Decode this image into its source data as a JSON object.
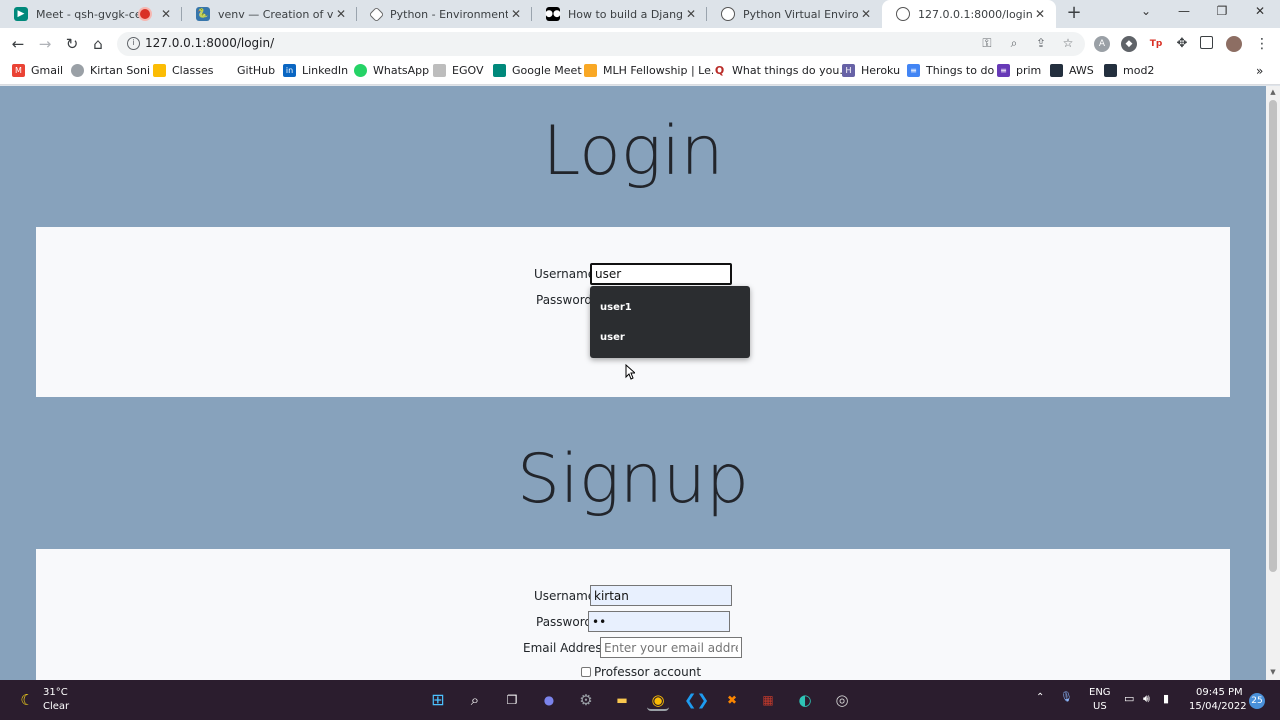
{
  "browser": {
    "tabs": [
      {
        "title": "Meet - qsh-gvgk-cev",
        "recording": true
      },
      {
        "title": "venv — Creation of virtual e"
      },
      {
        "title": "Python - Environment Setu"
      },
      {
        "title": "How to build a Django web"
      },
      {
        "title": "Python Virtual Environment"
      },
      {
        "title": "127.0.0.1:8000/login/",
        "active": true
      }
    ],
    "url": "127.0.0.1:8000/login/",
    "bookmarks": [
      "Gmail",
      "Kirtan Soni",
      "Classes",
      "GitHub",
      "LinkedIn",
      "WhatsApp",
      "EGOV",
      "Google Meet",
      "MLH Fellowship | Le...",
      "What things do you...",
      "Heroku",
      "Things to do",
      "prim",
      "AWS",
      "mod2"
    ],
    "accent": "#87a2bc"
  },
  "login": {
    "heading": "Login",
    "username_label": "Username",
    "username_value": "user",
    "password_label": "Password",
    "autocomplete": [
      "user1",
      "user"
    ]
  },
  "signup": {
    "heading": "Signup",
    "username_label": "Username",
    "username_value": "kirtan",
    "password_label": "Password",
    "password_value": "••",
    "email_label": "Email Address",
    "email_placeholder": "Enter your email address",
    "professor_label": "Professor account"
  },
  "taskbar": {
    "temperature": "31°C",
    "weather": "Clear",
    "lang": "ENG",
    "region": "US",
    "time": "09:45 PM",
    "date": "15/04/2022",
    "notifications": "25"
  }
}
